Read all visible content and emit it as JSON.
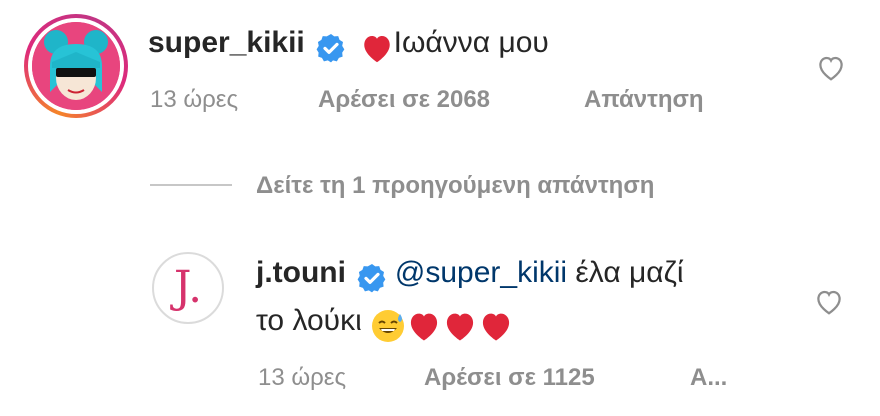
{
  "comment1": {
    "username": "super_kikii",
    "text": "Ιωάννα μου",
    "time": "13 ώρες",
    "likes": "Αρέσει σε 2068",
    "reply": "Απάντηση"
  },
  "view_replies": "Δείτε τη 1 προηγούμενη απάντηση",
  "reply1": {
    "username": "j.touni",
    "avatar_letter": "J.",
    "mention": "@super_kikii",
    "text_line1": " έλα μαζί",
    "text_line2": "το λούκι ",
    "time": "13 ώρες",
    "likes": "Αρέσει σε 1125",
    "reply": "Α..."
  },
  "colors": {
    "verified": "#3897f0",
    "heart": "#ed4956",
    "mention": "#00376b",
    "meta": "#8e8e8e"
  }
}
